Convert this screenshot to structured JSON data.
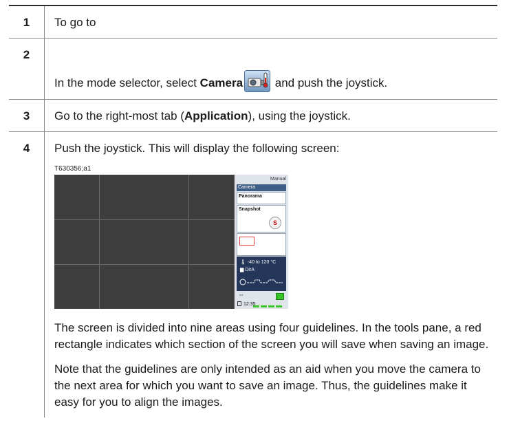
{
  "steps": [
    {
      "num": "1",
      "text": "To go to"
    },
    {
      "num": "2",
      "text_before": "In the mode selector, select ",
      "bold": "Camera",
      "text_after": " and push the joystick."
    },
    {
      "num": "3",
      "text_before": "Go to the right-most tab (",
      "bold": "Application",
      "text_after": "), using the joystick."
    },
    {
      "num": "4",
      "text": "Push the joystick. This will display the following screen:",
      "figure_label": "T630356;a1",
      "paragraphs": [
        "The screen is divided into nine areas using four guidelines. In the tools pane, a red rectangle indicates which section of the screen you will save when saving an image.",
        "Note that the guidelines are only intended as an aid when you move the camera to the next area for which you want to save an image. Thus, the guidelines make it easy for you to align the images."
      ]
    }
  ],
  "screen": {
    "mode": "Manual",
    "tab": "Camera",
    "item1": "Panorama",
    "item2": "Snapshot",
    "snapshot_button": "S",
    "range": "-40 to 120 °C",
    "dir": "DirA",
    "time": "12:35"
  },
  "icons": {
    "camera_mode": "camera-thermometer-icon",
    "thermometer": "thermometer-icon",
    "folder": "folder-icon",
    "usb": "usb-icon",
    "battery": "battery-icon",
    "calendar": "calendar-icon"
  },
  "colors": {
    "ir_background": "#3d3d3d",
    "pane_header": "#3f5f86",
    "status_dark": "#24375a",
    "red_rect": "#e23a3a",
    "battery": "#39c42c"
  }
}
